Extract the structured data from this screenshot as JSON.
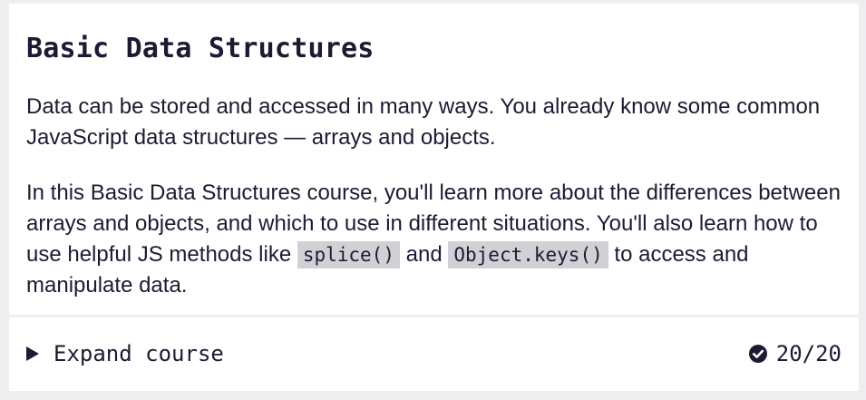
{
  "course": {
    "title": "Basic Data Structures",
    "intro": "Data can be stored and accessed in many ways. You already know some common JavaScript data structures — arrays and objects.",
    "detail_part1": "In this Basic Data Structures course, you'll learn more about the differences between arrays and objects, and which to use in different situations. You'll also learn how to use helpful JS methods like ",
    "code1": "splice()",
    "detail_part2": " and ",
    "code2": "Object.keys()",
    "detail_part3": " to access and manipulate data."
  },
  "footer": {
    "expand_label": "Expand course",
    "progress": "20/20",
    "expand_icon": "triangle-right-icon",
    "progress_icon": "check-circle-icon"
  },
  "colors": {
    "text": "#1b1b32",
    "background": "#eeeef0",
    "card": "#ffffff",
    "code_bg": "#d0d0d5"
  }
}
